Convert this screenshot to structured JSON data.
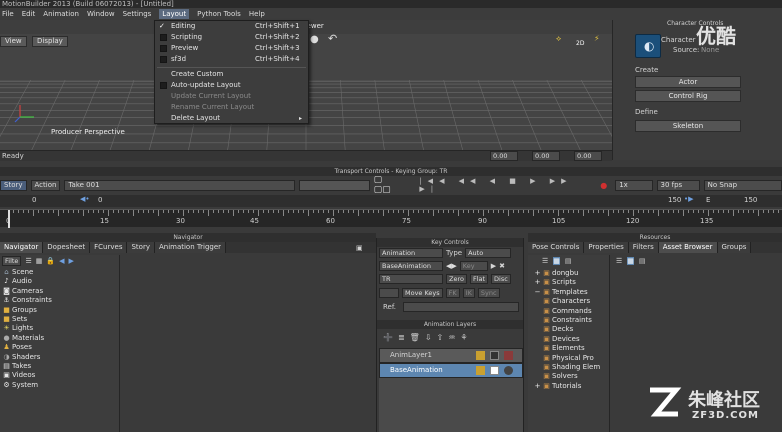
{
  "app": {
    "title": "MotionBuilder 2013 (Build 06072013) - [Untitled]"
  },
  "menu": [
    "File",
    "Edit",
    "Animation",
    "Window",
    "Settings",
    "Layout",
    "Python Tools",
    "Help"
  ],
  "layout_menu": {
    "items": [
      {
        "label": "Editing",
        "shortcut": "Ctrl+Shift+1",
        "checked": true
      },
      {
        "label": "Scripting",
        "shortcut": "Ctrl+Shift+2"
      },
      {
        "label": "Preview",
        "shortcut": "Ctrl+Shift+3"
      },
      {
        "label": "sf3d",
        "shortcut": "Ctrl+Shift+4"
      },
      {
        "label": "Create Custom"
      },
      {
        "label": "Auto-update Layout"
      },
      {
        "label": "Update Current Layout",
        "disabled": true
      },
      {
        "label": "Rename Current Layout",
        "disabled": true
      },
      {
        "label": "Delete Layout",
        "submenu": true
      }
    ]
  },
  "viewer": {
    "title": "Viewer",
    "view_label": "View",
    "display_label": "Display",
    "camera_label": "Producer Perspective",
    "mode_2d": "2D",
    "status": "Ready",
    "status_fields": [
      "0.00",
      "0.00",
      "0.00"
    ]
  },
  "character": {
    "panel_title": "Character Controls",
    "char_label": "Character",
    "source_label": "Source:",
    "source_value": "None",
    "create_label": "Create",
    "actor_btn": "Actor",
    "control_rig_btn": "Control Rig",
    "define_label": "Define",
    "skeleton_btn": "Skeleton"
  },
  "transport": {
    "title": "Transport Controls - Keying Group: TR",
    "story": "Story",
    "action": "Action",
    "take": "Take 001",
    "speed": "1x",
    "fps": "30 fps",
    "snap": "No Snap",
    "start": "0",
    "current": "0",
    "end": "150",
    "end_field": "150",
    "e_label": "E",
    "ruler": [
      "0",
      "15",
      "30",
      "45",
      "60",
      "75",
      "90",
      "105",
      "120",
      "135"
    ]
  },
  "navigator": {
    "title": "Navigator",
    "tabs": [
      "Navigator",
      "Dopesheet",
      "FCurves",
      "Story",
      "Animation Trigger"
    ],
    "filter": "Filte",
    "items": [
      "Scene",
      "Audio",
      "Cameras",
      "Constraints",
      "Groups",
      "Sets",
      "Lights",
      "Materials",
      "Poses",
      "Shaders",
      "Takes",
      "Videos",
      "System"
    ]
  },
  "key_controls": {
    "title": "Key Controls",
    "animation_label": "Animation",
    "type_label": "Type",
    "type_value": "Auto",
    "layer_value": "BaseAnimation",
    "key_label": "Key",
    "tr_value": "TR",
    "zero": "Zero",
    "flat": "Flat",
    "disc": "Disc",
    "move_keys": "Move Keys",
    "fk": "FK",
    "ik": "IK",
    "sync": "Sync",
    "ref_label": "Ref."
  },
  "anim_layers": {
    "title": "Animation Layers",
    "layers": [
      "AnimLayer1",
      "BaseAnimation"
    ]
  },
  "resources": {
    "title": "Resources",
    "tabs": [
      "Pose Controls",
      "Properties",
      "Filters",
      "Asset Browser",
      "Groups"
    ],
    "tree": [
      "dongbu",
      "Scripts",
      "Templates",
      "Characters",
      "Commands",
      "Constraints",
      "Decks",
      "Devices",
      "Elements",
      "Physical Pro",
      "Shading Elem",
      "Solvers",
      "Tutorials"
    ]
  },
  "watermarks": {
    "top": "优酷",
    "brand": "朱峰社区",
    "site": "ZF3D.COM"
  }
}
